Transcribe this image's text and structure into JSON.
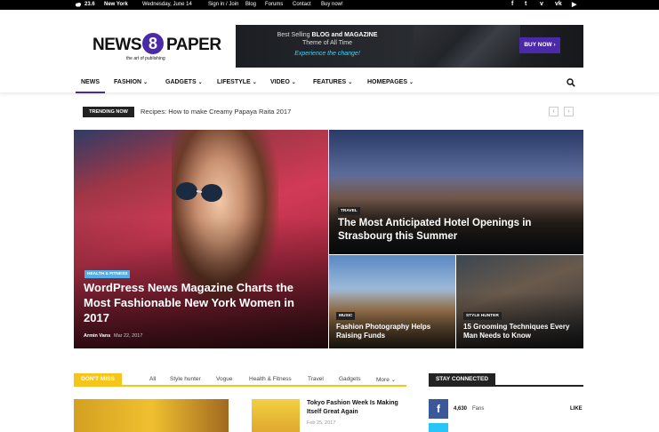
{
  "topbar": {
    "temperature": "23.6",
    "city": "New York",
    "date": "Wednesday, June 14",
    "links": [
      "Sign in / Join",
      "Blog",
      "Forums",
      "Contact",
      "Buy now!"
    ],
    "social_icons": [
      "facebook-icon",
      "twitter-icon",
      "vimeo-icon",
      "vk-icon",
      "youtube-icon"
    ]
  },
  "logo": {
    "word1": "NEWS",
    "number": "8",
    "word2": "PAPER",
    "tagline": "the art of publishing"
  },
  "banner": {
    "line1_prefix": "Best Selling ",
    "line1_bold": "BLOG and MAGAZINE",
    "line2": "Theme of All Time",
    "line3": "Experience the change!",
    "button": "BUY NOW ›"
  },
  "nav": {
    "items": [
      {
        "label": "NEWS",
        "dropdown": false
      },
      {
        "label": "FASHION",
        "dropdown": true
      },
      {
        "label": "GADGETS",
        "dropdown": true
      },
      {
        "label": "LIFESTYLE",
        "dropdown": true
      },
      {
        "label": "VIDEO",
        "dropdown": true
      },
      {
        "label": "FEATURES",
        "dropdown": true
      },
      {
        "label": "HOMEPAGES",
        "dropdown": true
      }
    ],
    "chevron": "⌄"
  },
  "trending": {
    "label": "TRENDING NOW",
    "headline": "Recipes: How to make Creamy Papaya Raita 2017",
    "prev": "‹",
    "next": "›"
  },
  "featured": [
    {
      "category": "HEALTH & FITNESS",
      "title": "WordPress News Magazine Charts the Most Fashionable New York Women in 2017",
      "author": "Armin Vans",
      "date": "Mar 22, 2017"
    },
    {
      "category": "TRAVEL",
      "title": "The Most Anticipated Hotel Openings in Strasbourg this Summer"
    },
    {
      "category": "MUSIC",
      "title": "Fashion Photography Helps Raising Funds"
    },
    {
      "category": "STYLE HUNTER",
      "title": "15 Grooming Techniques Every Man Needs to Know"
    }
  ],
  "dont_miss": {
    "label": "DON'T MISS",
    "tabs": [
      "All",
      "Style hunter",
      "Vogue",
      "Health & Fitness",
      "Travel",
      "Gadgets",
      "More"
    ],
    "more_chevron": "⌄",
    "post_title": "Tokyo Fashion Week Is Making Itself Great Again",
    "post_date": "Feb 25, 2017"
  },
  "stay_connected": {
    "label": "STAY CONNECTED",
    "facebook_count": "4,630",
    "facebook_unit": "Fans",
    "facebook_action": "LIKE"
  }
}
